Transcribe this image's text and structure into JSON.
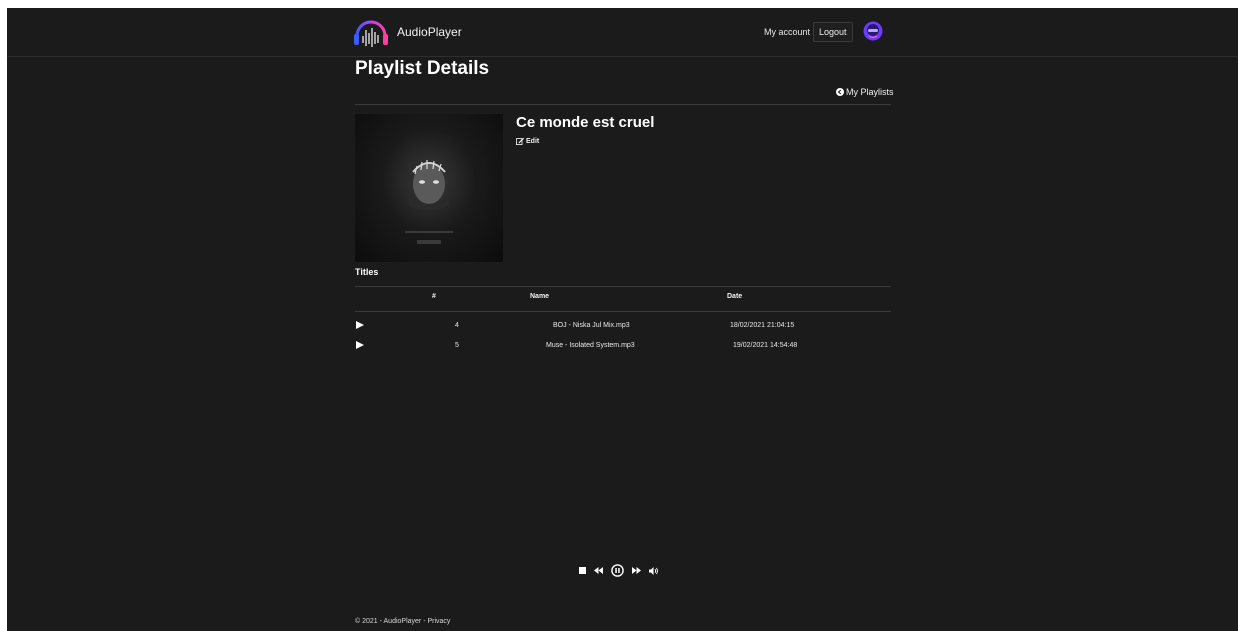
{
  "header": {
    "brand": "AudioPlayer",
    "my_account": "My account",
    "logout": "Logout"
  },
  "page": {
    "title": "Playlist Details",
    "my_playlists": "My Playlists"
  },
  "playlist": {
    "name": "Ce monde est cruel",
    "edit_label": "Edit"
  },
  "titles": {
    "heading": "Titles",
    "columns": [
      "#",
      "Name",
      "Date"
    ],
    "rows": [
      {
        "number": "4",
        "name": "BOJ - Niska Jul Mix.mp3",
        "date": "18/02/2021 21:04:15"
      },
      {
        "number": "5",
        "name": "Muse - Isolated System.mp3",
        "date": "19/02/2021 14:54:48"
      }
    ]
  },
  "player": {
    "controls": [
      "stop-icon",
      "rewind-icon",
      "pause-icon",
      "fast-forward-icon",
      "volume-icon"
    ]
  },
  "footer": {
    "copyright": "© 2021 - AudioPlayer - ",
    "privacy": "Privacy"
  },
  "colors": {
    "background": "#1b1b1b",
    "text": "#ffffff",
    "brand_gradient": [
      "#3a5bff",
      "#c53cff",
      "#ff3fa4"
    ]
  }
}
